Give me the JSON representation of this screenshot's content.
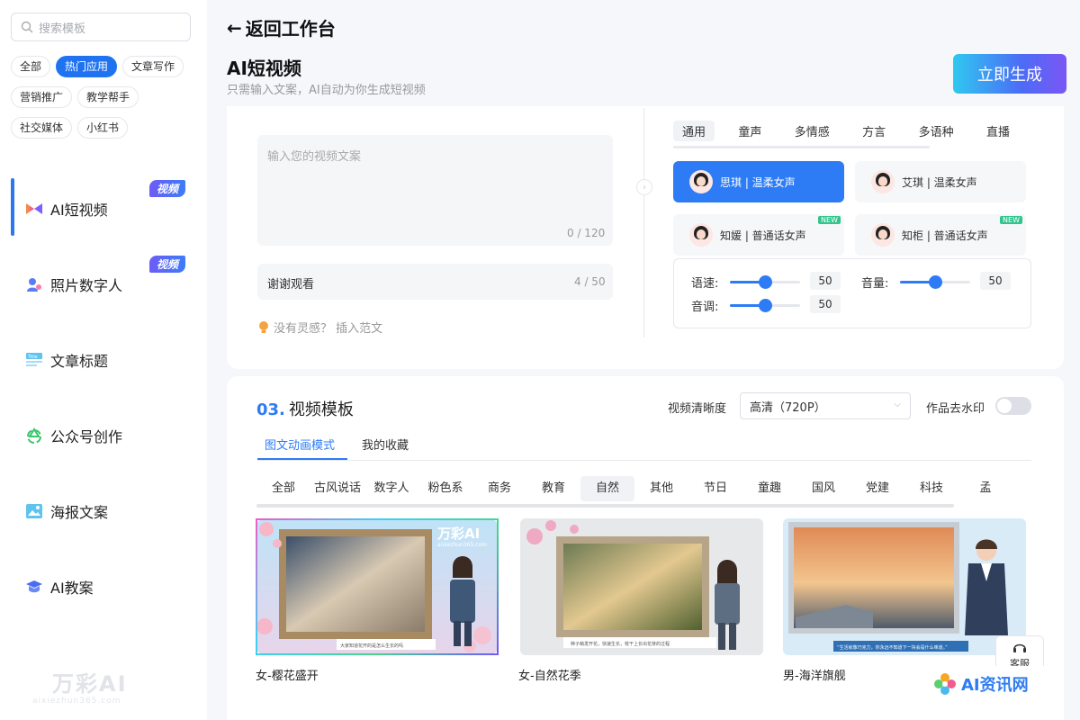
{
  "sidebar": {
    "search_placeholder": "搜索模板",
    "tags": [
      "全部",
      "热门应用",
      "文章写作",
      "营销推广",
      "教学帮手",
      "社交媒体",
      "小红书"
    ],
    "active_tag": "热门应用",
    "menu": [
      {
        "label": "AI短视频",
        "badge": "视频",
        "icon": "video-bow-icon",
        "active": true
      },
      {
        "label": "照片数字人",
        "badge": "视频",
        "icon": "digital-human-icon"
      },
      {
        "label": "文章标题",
        "badge": "",
        "icon": "title-icon"
      },
      {
        "label": "公众号创作",
        "badge": "",
        "icon": "wechat-recycle-icon"
      },
      {
        "label": "海报文案",
        "badge": "",
        "icon": "poster-icon"
      },
      {
        "label": "AI教案",
        "badge": "",
        "icon": "graduation-cap-icon"
      }
    ],
    "logo_text": "万彩AI",
    "logo_sub": "aixiezhun365.com"
  },
  "header": {
    "back_label": "返回工作台",
    "title": "AI短视频",
    "subtitle": "只需输入文案，AI自动为你生成短视频",
    "generate_label": "立即生成"
  },
  "script_input": {
    "placeholder": "输入您的视频文案",
    "count": "0 / 120",
    "ending_value": "谢谢观看",
    "ending_count": "4 / 50",
    "inspiration_label": "没有灵感？ 插入范文"
  },
  "voice": {
    "tabs": [
      "通用",
      "童声",
      "多情感",
      "方言",
      "多语种",
      "直播"
    ],
    "active_tab": "通用",
    "options": [
      {
        "label": "思琪 | 温柔女声",
        "active": true,
        "new": false
      },
      {
        "label": "艾琪 | 温柔女声",
        "active": false,
        "new": false
      },
      {
        "label": "知媛 | 普通话女声",
        "active": false,
        "new": true
      },
      {
        "label": "知柜 | 普通话女声",
        "active": false,
        "new": true
      }
    ],
    "new_badge": "NEW",
    "sliders": [
      {
        "label": "语速:",
        "value": "50",
        "level": 0.5
      },
      {
        "label": "音量:",
        "value": "50",
        "level": 0.5
      },
      {
        "label": "音调:",
        "value": "50",
        "level": 0.5
      }
    ]
  },
  "template": {
    "section_num": "03.",
    "section_title": "视频模板",
    "quality_label": "视频清晰度",
    "quality_value": "高清（720P）",
    "watermark_label": "作品去水印",
    "modes": [
      "图文动画模式",
      "我的收藏"
    ],
    "categories": [
      "全部",
      "古风说话",
      "数字人",
      "粉色系",
      "商务",
      "教育",
      "自然",
      "其他",
      "节日",
      "童趣",
      "国风",
      "党建",
      "科技",
      "孟"
    ],
    "active_category": "自然",
    "cards": [
      {
        "caption": "女-樱花盛开",
        "overlay_title": "万彩AI",
        "overlay_sub": "aixiezhun365.com",
        "subtitle": "大家知道花开的是怎么生长的吗"
      },
      {
        "caption": "女-自然花季",
        "subtitle": "种子萌发开花，快速生长，枝干上长出花芽的过程"
      },
      {
        "caption": "男-海洋旗舰",
        "subtitle": "“生活就像巧克力，你永远不知道下一块会是什么味道。”"
      }
    ]
  },
  "help_label": "客服",
  "watermark_ai": "AI资讯网",
  "colors": {
    "accent": "#2d7cf6",
    "new_badge": "#31c48d",
    "badge": "#5b6cf6"
  }
}
